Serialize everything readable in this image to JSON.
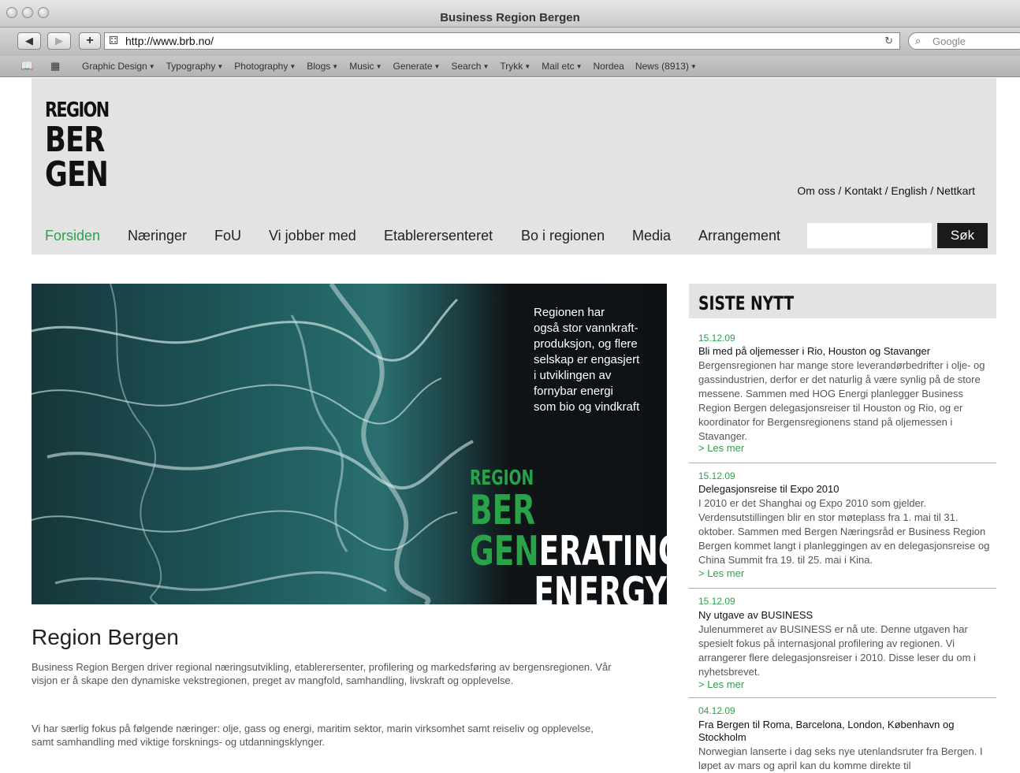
{
  "browser": {
    "window_title": "Business Region Bergen",
    "url": "http://www.brb.no/",
    "search_placeholder": "Google",
    "bookmarks": [
      "Graphic Design",
      "Typography",
      "Photography",
      "Blogs",
      "Music",
      "Generate",
      "Search",
      "Trykk",
      "Mail etc",
      "Nordea",
      "News (8913)"
    ],
    "bookmarks_with_menu": [
      true,
      true,
      true,
      true,
      true,
      true,
      true,
      true,
      true,
      false,
      true
    ]
  },
  "site": {
    "logo": {
      "line1": "REGION",
      "line2": "BER",
      "line3": "GEN"
    },
    "util_links": "Om oss / Kontakt / English / Nettkart",
    "nav": [
      "Forsiden",
      "Næringer",
      "FoU",
      "Vi jobber med",
      "Etablerersenteret",
      "Bo i regionen",
      "Media",
      "Arrangement"
    ],
    "active_nav": "Forsiden",
    "search_button": "Søk",
    "accent_color": "#2aa24a"
  },
  "hero": {
    "text": "Regionen har\nogså stor vannkraft-\nproduksjon, og flere\nselskap er engasjert\ni utviklingen av\nfornybar energi\nsom bio og vindkraft",
    "logo": {
      "l1": "REGION",
      "l2": "BER",
      "l3_green": "GEN",
      "l3_white": "ERATING",
      "l4": "ENERGY"
    }
  },
  "main": {
    "title": "Region Bergen",
    "para1": "Business Region Bergen driver regional næringsutvikling, etablerersenter, profilering og markedsføring av bergensregionen. Vår visjon er å skape den dynamiske vekstregionen, preget av mangfold, samhandling, livskraft og opplevelse.",
    "para2": "Vi har særlig fokus på følgende næringer: olje, gass og energi, maritim sektor, marin virksomhet samt reiseliv og opplevelse, samt samhandling med viktige forsknings- og utdanningsklynger."
  },
  "sidebar": {
    "heading": "SISTE NYTT",
    "news": [
      {
        "date": "15.12.09",
        "title": "Bli med på oljemesser i Rio, Houston og Stavanger",
        "body": "Bergensregionen har mange store leverandørbedrifter i olje- og gassindustrien, derfor er det naturlig å være synlig på de store messene. Sammen med HOG Energi planlegger Business Region Bergen delegasjonsreiser til Houston og Rio, og er koordinator for Bergensregionens stand på oljemessen i Stavanger.",
        "more": "> Les mer"
      },
      {
        "date": "15.12.09",
        "title": "Delegasjonsreise til Expo 2010",
        "body": "I 2010 er det Shanghai og Expo 2010 som gjelder. Verdensutstillingen blir en stor møteplass fra 1. mai til 31. oktober. Sammen med Bergen Næringsråd er Business Region Bergen kommet langt i planleggingen av en delegasjonsreise og China Summit fra 19. til 25. mai i Kina.",
        "more": "> Les mer"
      },
      {
        "date": "15.12.09",
        "title": "Ny utgave av BUSINESS",
        "body": "Julenummeret av BUSINESS er nå ute. Denne utgaven har spesielt fokus på internasjonal profilering av regionen. Vi arrangerer flere delegasjonsreiser i 2010. Disse leser du om i nyhetsbrevet.",
        "more": "> Les mer"
      },
      {
        "date": "04.12.09",
        "title": "Fra Bergen til Roma, Barcelona, London, København og Stockholm",
        "body": "Norwegian lanserte i dag seks nye utenlandsruter fra Bergen. I løpet av mars og april kan du komme direkte til",
        "more": ""
      }
    ]
  }
}
